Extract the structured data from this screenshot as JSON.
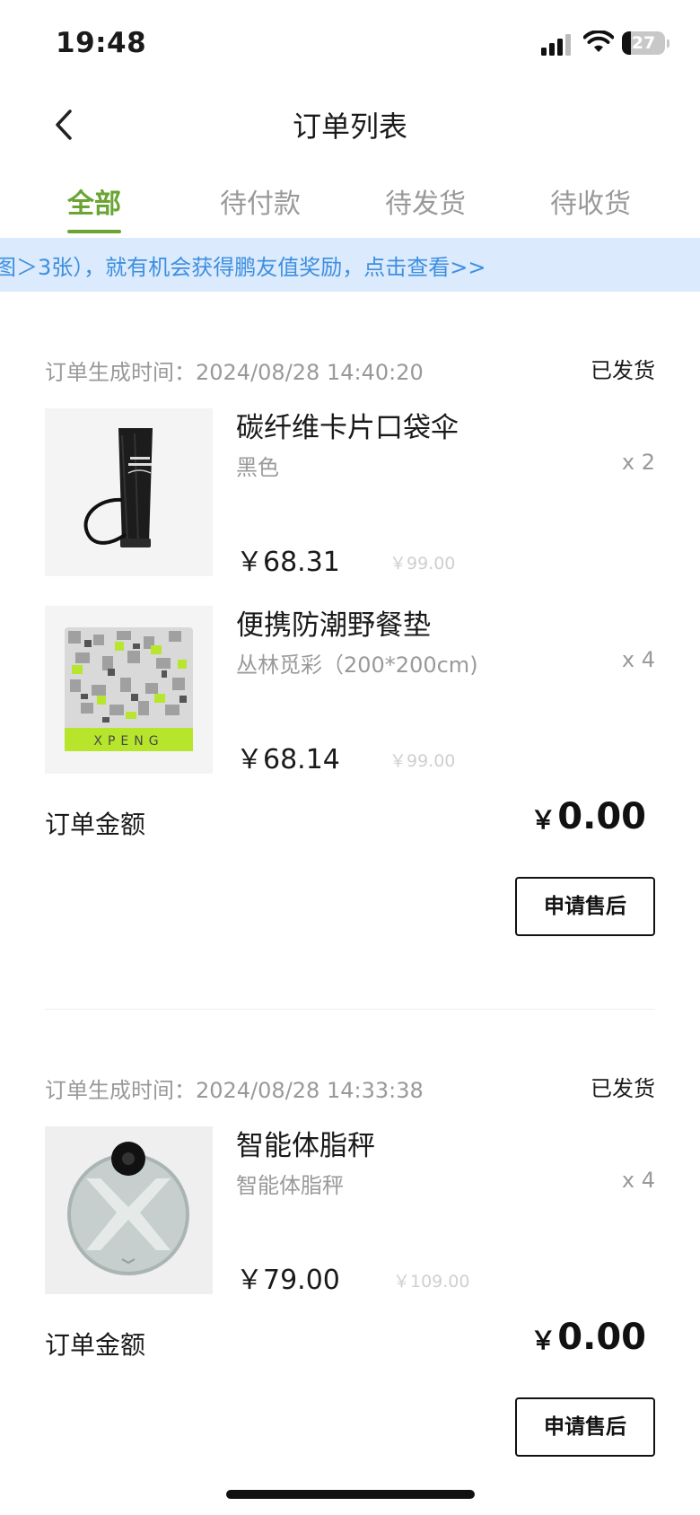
{
  "status_bar": {
    "time": "19:48",
    "battery": "27"
  },
  "nav": {
    "title": "订单列表"
  },
  "tabs": [
    {
      "label": "全部",
      "active": true
    },
    {
      "label": "待付款",
      "active": false
    },
    {
      "label": "待发货",
      "active": false
    },
    {
      "label": "待收货",
      "active": false
    }
  ],
  "banner": {
    "text": "图＞3张），就有机会获得鹏友值奖励，点击查看>>"
  },
  "orders": [
    {
      "time_label": "订单生成时间：2024/08/28 14:40:20",
      "status": "已发货",
      "items": [
        {
          "name": "碳纤维卡片口袋伞",
          "spec": "黑色",
          "qty": "x 2",
          "price": "￥68.31",
          "orig_price": "￥99.00"
        },
        {
          "name": "便携防潮野餐垫",
          "spec": "丛林觅彩（200*200cm)",
          "qty": "x 4",
          "price": "￥68.14",
          "orig_price": "￥99.00"
        }
      ],
      "amount_label": "订单金额",
      "amount_currency": "￥",
      "amount_value": "0.00",
      "button": "申请售后"
    },
    {
      "time_label": "订单生成时间：2024/08/28 14:33:38",
      "status": "已发货",
      "items": [
        {
          "name": "智能体脂秤",
          "spec": "智能体脂秤",
          "qty": "x 4",
          "price": "￥79.00",
          "orig_price": "￥109.00"
        }
      ],
      "amount_label": "订单金额",
      "amount_currency": "￥",
      "amount_value": "0.00",
      "button": "申请售后"
    }
  ],
  "product_image_text": {
    "mat_logo": "XPENG"
  },
  "colors": {
    "accent": "#6aa534",
    "banner_bg": "#dbeafc",
    "banner_text": "#3d8fe0"
  }
}
